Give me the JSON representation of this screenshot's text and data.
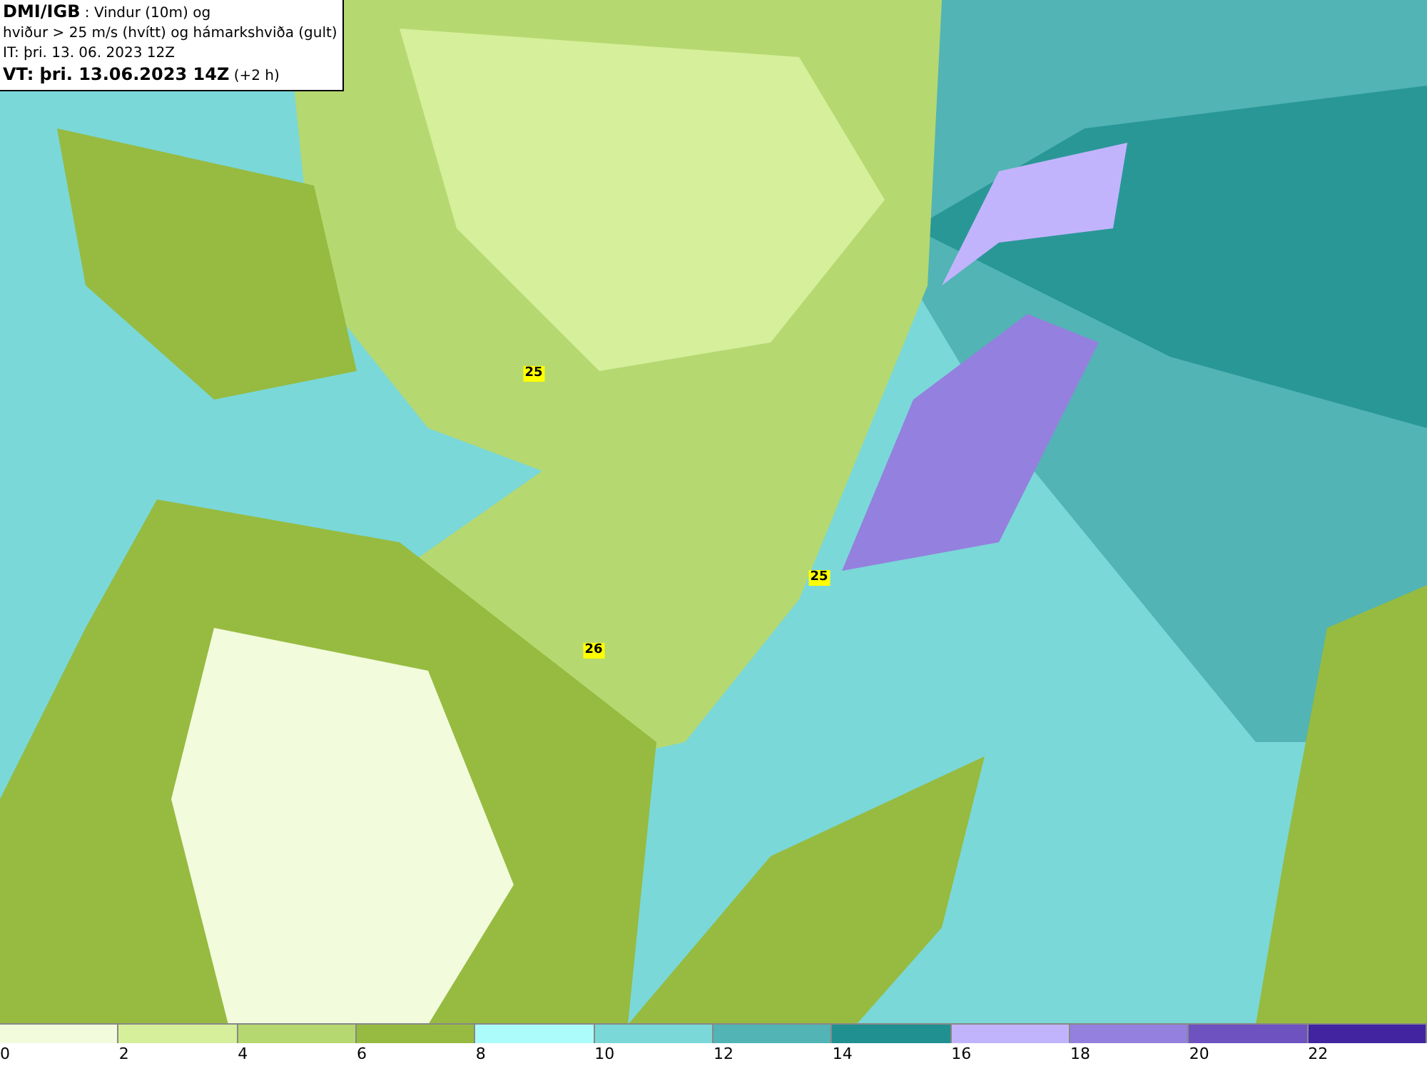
{
  "info_box": {
    "lines": [
      "**DMI/IGB** : Vindur (10m) og",
      "hviður > 25 m/s (hvítt) og hámarkshviða (gult)",
      "IT: þri. 13. 06. 2023 12Z",
      "**VT: þri. 13.06.2023 14Z** (+2 h)"
    ]
  },
  "gust_markers": [
    "25",
    "26",
    "25"
  ],
  "legend": {
    "bins": [
      {
        "label": "0",
        "color": "#f2fbdc"
      },
      {
        "label": "2",
        "color": "#d6ef9a"
      },
      {
        "label": "4",
        "color": "#b6d870"
      },
      {
        "label": "6",
        "color": "#96bb40"
      },
      {
        "label": "8",
        "color": "#adfcfc"
      },
      {
        "label": "10",
        "color": "#7ad8d8"
      },
      {
        "label": "12",
        "color": "#52b4b4"
      },
      {
        "label": "14",
        "color": "#219090"
      },
      {
        "label": "16",
        "color": "#c2b4fc"
      },
      {
        "label": "18",
        "color": "#9480de"
      },
      {
        "label": "20",
        "color": "#6e52c0"
      },
      {
        "label": "22",
        "color": "#4224a0"
      }
    ]
  }
}
